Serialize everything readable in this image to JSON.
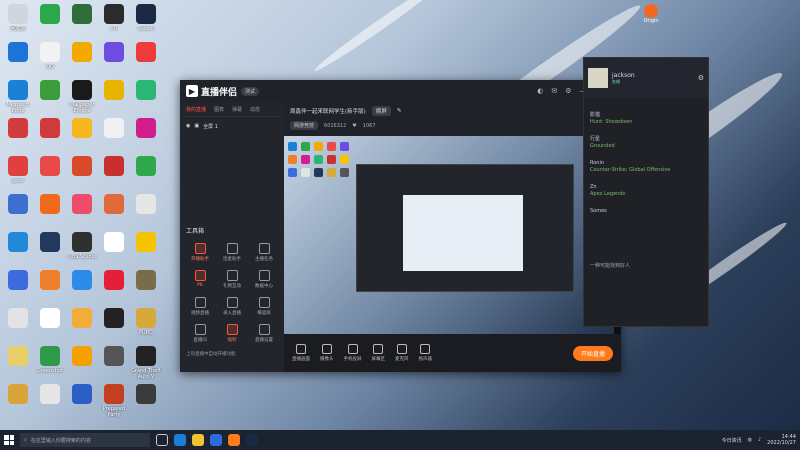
{
  "desktop": {
    "col1": [
      {
        "label": "回收站",
        "color": "#cfd6de"
      },
      {
        "label": "",
        "color": "#1e73d6"
      },
      {
        "label": "Microsoft Edge",
        "color": "#1b80d6"
      },
      {
        "label": "",
        "color": "#d23b3b"
      },
      {
        "label": "geek",
        "color": "#e04040"
      },
      {
        "label": "",
        "color": "#3c6fd0"
      },
      {
        "label": "",
        "color": "#1f8bd8"
      },
      {
        "label": "",
        "color": "#3b6bdc"
      },
      {
        "label": "",
        "color": "#e3e3e3"
      },
      {
        "label": "",
        "color": "#e8cf6a"
      },
      {
        "label": "",
        "color": "#d8a43a"
      }
    ],
    "col2": [
      {
        "label": "",
        "color": "#2ca84a"
      },
      {
        "label": "QQ",
        "color": "#f2f2f2"
      },
      {
        "label": "",
        "color": "#3b9c3b"
      },
      {
        "label": "",
        "color": "#cf3b3b"
      },
      {
        "label": "",
        "color": "#e84a4a"
      },
      {
        "label": "",
        "color": "#f06a1a"
      },
      {
        "label": "",
        "color": "#22395e"
      },
      {
        "label": "",
        "color": "#ef7f2d"
      },
      {
        "label": "",
        "color": "#ffffff"
      },
      {
        "label": "Greenshot",
        "color": "#2f9a4a"
      },
      {
        "label": "",
        "color": "#e6e6e6"
      }
    ],
    "col3": [
      {
        "label": "",
        "color": "#2f6d3a"
      },
      {
        "label": "",
        "color": "#f2a900"
      },
      {
        "label": "Wallpaper Engine",
        "color": "#1a1a1a"
      },
      {
        "label": "",
        "color": "#f5b81e"
      },
      {
        "label": "",
        "color": "#d94a2b"
      },
      {
        "label": "",
        "color": "#ef4b6a"
      },
      {
        "label": "OBS Studio",
        "color": "#303030"
      },
      {
        "label": "",
        "color": "#2a8ce8"
      },
      {
        "label": "",
        "color": "#f2ac3a"
      },
      {
        "label": "",
        "color": "#f4a000"
      },
      {
        "label": "",
        "color": "#2b5fc7"
      }
    ],
    "col4": [
      {
        "label": "VR",
        "color": "#2b2b2b"
      },
      {
        "label": "",
        "color": "#6d4de0"
      },
      {
        "label": "",
        "color": "#e8b400"
      },
      {
        "label": "",
        "color": "#f0f0f0"
      },
      {
        "label": "",
        "color": "#c83030"
      },
      {
        "label": "",
        "color": "#e06a3a"
      },
      {
        "label": "",
        "color": "#ffffff"
      },
      {
        "label": "",
        "color": "#e61e3a"
      },
      {
        "label": "",
        "color": "#222222"
      },
      {
        "label": "",
        "color": "#555555"
      },
      {
        "label": "Prepared Party",
        "color": "#c2401f"
      }
    ],
    "col5": [
      {
        "label": "Steam",
        "color": "#1a2a44"
      },
      {
        "label": "",
        "color": "#ef3b3b"
      },
      {
        "label": "",
        "color": "#2bb673"
      },
      {
        "label": "",
        "color": "#d11e8c"
      },
      {
        "label": "",
        "color": "#2ea84a"
      },
      {
        "label": "",
        "color": "#e6e6e6"
      },
      {
        "label": "",
        "color": "#f4c400"
      },
      {
        "label": "",
        "color": "#7a6b4a"
      },
      {
        "label": "PUBG",
        "color": "#d6a93a"
      },
      {
        "label": "Grand Theft Auto V",
        "color": "#222222"
      },
      {
        "label": "",
        "color": "#3a3a3a"
      }
    ]
  },
  "origin": {
    "label": "Origin",
    "color": "#f26a21"
  },
  "app": {
    "name": "直播伴侣",
    "version": "测试",
    "tabs": [
      "我的直播",
      "图表",
      "弹幕",
      "动态"
    ],
    "scene": "全屏 1",
    "tools_title": "工具箱",
    "tools": [
      {
        "label": "开播助手",
        "hot": true
      },
      {
        "label": "连麦助手",
        "hot": false
      },
      {
        "label": "主播任务",
        "hot": false
      },
      {
        "label": "PK",
        "hot": true
      },
      {
        "label": "礼物互动",
        "hot": false
      },
      {
        "label": "数据中心",
        "hot": false
      },
      {
        "label": "视频直播",
        "hot": false
      },
      {
        "label": "录入直播",
        "hot": false
      },
      {
        "label": "横竖屏",
        "hot": false
      },
      {
        "label": "直播间",
        "hot": false
      },
      {
        "label": "福利",
        "hot": true
      },
      {
        "label": "直播设置",
        "hot": false
      }
    ],
    "footer_text": "上热直播中自动开播功能",
    "room_title": "周鑫伴一起来联网学生(新手版)",
    "room_badge": "横屏",
    "room_category": "网游竞技",
    "room_id": "6016312",
    "room_fans": "1067",
    "controls": [
      "直播画面",
      "摄像头",
      "手机投屏",
      "屏幕区",
      "麦克风",
      "扬声器"
    ],
    "go_live": "开始直播"
  },
  "steam": {
    "username": "jackson",
    "status": "在线",
    "friends": [
      {
        "name": "影猎",
        "game": "Hunt: Showdown"
      },
      {
        "name": "行星",
        "game": "Grounded"
      },
      {
        "name": "Ronin",
        "game": "Counter-Strike: Global Offensive"
      },
      {
        "name": "Zn",
        "game": "Apex Legends"
      },
      {
        "name": "Somes",
        "game": ""
      }
    ],
    "footer_text": "一种可能找到好人"
  },
  "taskbar": {
    "search_placeholder": "在这里输入你要搜索的内容",
    "time": "14:44",
    "date": "2022/10/27",
    "weather": "今日资讯"
  }
}
